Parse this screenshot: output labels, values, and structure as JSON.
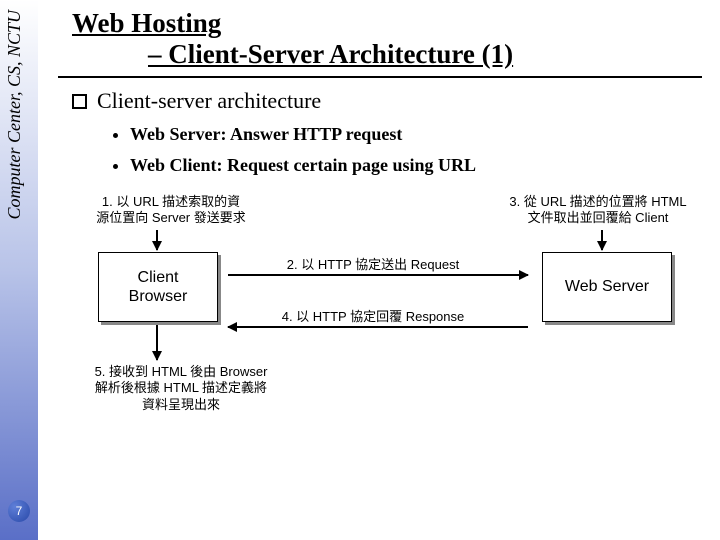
{
  "sidebar_label": "Computer Center, CS, NCTU",
  "page_number": "7",
  "title_line1": "Web Hosting",
  "title_line2": "– Client-Server Architecture (1)",
  "section_heading": "Client-server architecture",
  "bullets": [
    "Web Server: Answer HTTP request",
    "Web Client: Request certain page using URL"
  ],
  "diagram": {
    "client_label": "Client\nBrowser",
    "server_label": "Web Server",
    "step1": "1. 以 URL 描述索取的資\n源位置向 Server 發送要求",
    "step2": "2. 以 HTTP 協定送出 Request",
    "step3": "3. 從 URL 描述的位置將 HTML\n文件取出並回覆給 Client",
    "step4": "4. 以 HTTP 協定回覆 Response",
    "step5": "5. 接收到 HTML 後由 Browser\n解析後根據 HTML 描述定義將\n資料呈現出來"
  }
}
